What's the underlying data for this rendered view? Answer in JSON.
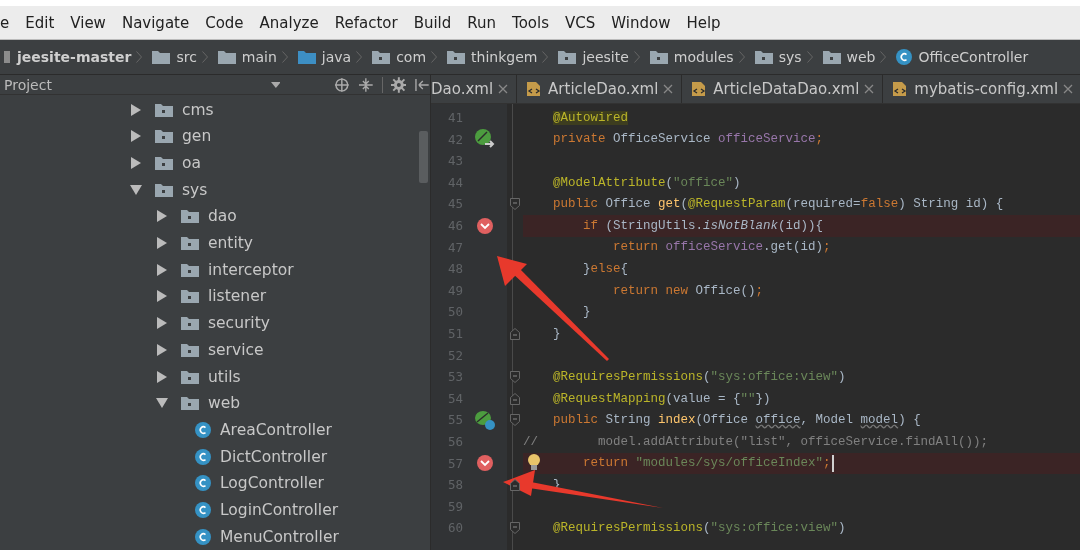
{
  "menu": [
    "e",
    "Edit",
    "View",
    "Navigate",
    "Code",
    "Analyze",
    "Refactor",
    "Build",
    "Run",
    "Tools",
    "VCS",
    "Window",
    "Help"
  ],
  "breadcrumb": [
    {
      "label": "jeesite-master",
      "kind": "project"
    },
    {
      "label": "src",
      "kind": "folder"
    },
    {
      "label": "main",
      "kind": "folder"
    },
    {
      "label": "java",
      "kind": "source"
    },
    {
      "label": "com",
      "kind": "package"
    },
    {
      "label": "thinkgem",
      "kind": "package"
    },
    {
      "label": "jeesite",
      "kind": "package"
    },
    {
      "label": "modules",
      "kind": "package"
    },
    {
      "label": "sys",
      "kind": "package"
    },
    {
      "label": "web",
      "kind": "package"
    },
    {
      "label": "OfficeController",
      "kind": "class"
    }
  ],
  "project_panel": {
    "title": "Project"
  },
  "tabs": [
    {
      "label": "Dao.xml",
      "selected": false
    },
    {
      "label": "ArticleDao.xml",
      "selected": false
    },
    {
      "label": "ArticleDataDao.xml",
      "selected": false
    },
    {
      "label": "mybatis-config.xml",
      "selected": false
    }
  ],
  "tree": [
    {
      "label": "cms",
      "kind": "package",
      "expanded": false
    },
    {
      "label": "gen",
      "kind": "package",
      "expanded": false
    },
    {
      "label": "oa",
      "kind": "package",
      "expanded": false
    },
    {
      "label": "sys",
      "kind": "package",
      "expanded": true,
      "children": [
        {
          "label": "dao",
          "kind": "package",
          "expanded": false
        },
        {
          "label": "entity",
          "kind": "package",
          "expanded": false
        },
        {
          "label": "interceptor",
          "kind": "package",
          "expanded": false
        },
        {
          "label": "listener",
          "kind": "package",
          "expanded": false
        },
        {
          "label": "security",
          "kind": "package",
          "expanded": false
        },
        {
          "label": "service",
          "kind": "package",
          "expanded": false
        },
        {
          "label": "utils",
          "kind": "package",
          "expanded": false
        },
        {
          "label": "web",
          "kind": "package",
          "expanded": true,
          "children": [
            {
              "label": "AreaController",
              "kind": "class"
            },
            {
              "label": "DictController",
              "kind": "class"
            },
            {
              "label": "LogController",
              "kind": "class"
            },
            {
              "label": "LoginController",
              "kind": "class"
            },
            {
              "label": "MenuController",
              "kind": "class"
            }
          ]
        }
      ]
    }
  ],
  "code": [
    {
      "num": "41",
      "kind": "plain",
      "fold_start": false,
      "fold_end": false,
      "tokens": [
        {
          "t": "    @Autowired",
          "color": "#bbb529",
          "highlighted": true
        }
      ]
    },
    {
      "num": "42",
      "kind": "bean",
      "fold_start": false,
      "fold_end": false,
      "tokens": [
        {
          "t": "    private ",
          "color": "#cc7832"
        },
        {
          "t": "OfficeService "
        },
        {
          "t": "officeService",
          "color": "#9876aa"
        },
        {
          "t": ";",
          "color": "#cc7832"
        }
      ]
    },
    {
      "num": "43",
      "kind": "plain",
      "fold_start": false,
      "fold_end": false
    },
    {
      "num": "44",
      "kind": "plain",
      "fold_start": false,
      "fold_end": false,
      "tokens": [
        {
          "t": "    @ModelAttribute",
          "color": "#bbb529"
        },
        {
          "t": "("
        },
        {
          "t": "\"office\"",
          "color": "#6a8759"
        },
        {
          "t": ")"
        }
      ]
    },
    {
      "num": "45",
      "kind": "plain",
      "fold_start": true,
      "fold_end": false,
      "tokens": [
        {
          "t": "    public ",
          "color": "#cc7832"
        },
        {
          "t": "Office "
        },
        {
          "t": "get",
          "color": "#ffc66d"
        },
        {
          "t": "("
        },
        {
          "t": "@RequestParam",
          "color": "#bbb529"
        },
        {
          "t": "(required="
        },
        {
          "t": "false",
          "color": "#cc7832"
        },
        {
          "t": ") String id) {"
        }
      ]
    },
    {
      "num": "46",
      "kind": "breakpoint",
      "fold_start": false,
      "fold_end": false,
      "tokens": [
        {
          "t": "        if ",
          "color": "#cc7832"
        },
        {
          "t": "(StringUtils."
        },
        {
          "t": "isNotBlank",
          "italic": true
        },
        {
          "t": "(id)){"
        }
      ]
    },
    {
      "num": "47",
      "kind": "plain",
      "fold_start": false,
      "fold_end": false,
      "tokens": [
        {
          "t": "            return ",
          "color": "#cc7832"
        },
        {
          "t": "officeService",
          "color": "#9876aa"
        },
        {
          "t": ".get(id)"
        },
        {
          "t": ";",
          "color": "#cc7832"
        }
      ]
    },
    {
      "num": "48",
      "kind": "plain",
      "fold_start": false,
      "fold_end": false,
      "tokens": [
        {
          "t": "        }"
        },
        {
          "t": "else",
          "color": "#cc7832"
        },
        {
          "t": "{"
        }
      ]
    },
    {
      "num": "49",
      "kind": "plain",
      "fold_start": false,
      "fold_end": false,
      "tokens": [
        {
          "t": "            return new ",
          "color": "#cc7832"
        },
        {
          "t": "Office()"
        },
        {
          "t": ";",
          "color": "#cc7832"
        }
      ]
    },
    {
      "num": "50",
      "kind": "plain",
      "fold_start": false,
      "fold_end": false,
      "tokens": [
        {
          "t": "        }"
        }
      ]
    },
    {
      "num": "51",
      "kind": "plain",
      "fold_start": false,
      "fold_end": true,
      "tokens": [
        {
          "t": "    }"
        }
      ]
    },
    {
      "num": "52",
      "kind": "plain",
      "fold_start": false,
      "fold_end": false
    },
    {
      "num": "53",
      "kind": "plain",
      "fold_start": true,
      "fold_end": false,
      "tokens": [
        {
          "t": "    @RequiresPermissions",
          "color": "#bbb529"
        },
        {
          "t": "("
        },
        {
          "t": "\"sys:office:view\"",
          "color": "#6a8759"
        },
        {
          "t": ")"
        }
      ]
    },
    {
      "num": "54",
      "kind": "plain",
      "fold_start": false,
      "fold_end": true,
      "tokens": [
        {
          "t": "    @RequestMapping",
          "color": "#bbb529"
        },
        {
          "t": "(value = {"
        },
        {
          "t": "\"\"",
          "color": "#6a8759"
        },
        {
          "t": "})"
        }
      ]
    },
    {
      "num": "55",
      "kind": "web",
      "fold_start": true,
      "fold_end": false,
      "tokens": [
        {
          "t": "    public ",
          "color": "#cc7832"
        },
        {
          "t": "String "
        },
        {
          "t": "index",
          "color": "#ffc66d"
        },
        {
          "t": "(Office "
        },
        {
          "t": "office",
          "unused": true
        },
        {
          "t": ", Model "
        },
        {
          "t": "model",
          "unused": true
        },
        {
          "t": ") {"
        }
      ]
    },
    {
      "num": "56",
      "kind": "plain",
      "fold_start": false,
      "fold_end": false,
      "tokens": [
        {
          "t": "//        model.addAttribute(\"list\", officeService.findAll());",
          "color": "#808080"
        }
      ]
    },
    {
      "num": "57",
      "kind": "breakpoint",
      "fold_start": false,
      "fold_end": false,
      "bulb": true,
      "caret": true,
      "tokens": [
        {
          "t": "        return ",
          "color": "#cc7832"
        },
        {
          "t": "\"modules/sys/officeIndex\"",
          "color": "#6a8759"
        },
        {
          "t": ";",
          "color": "#cc7832"
        }
      ]
    },
    {
      "num": "58",
      "kind": "plain",
      "fold_start": false,
      "fold_end": true,
      "tokens": [
        {
          "t": "    }"
        }
      ]
    },
    {
      "num": "59",
      "kind": "plain",
      "fold_start": false,
      "fold_end": false
    },
    {
      "num": "60",
      "kind": "plain",
      "fold_start": true,
      "fold_end": false,
      "tokens": [
        {
          "t": "    @RequiresPermissions",
          "color": "#bbb529"
        },
        {
          "t": "("
        },
        {
          "t": "\"sys:office:view\"",
          "color": "#6a8759"
        },
        {
          "t": ")"
        }
      ]
    }
  ]
}
